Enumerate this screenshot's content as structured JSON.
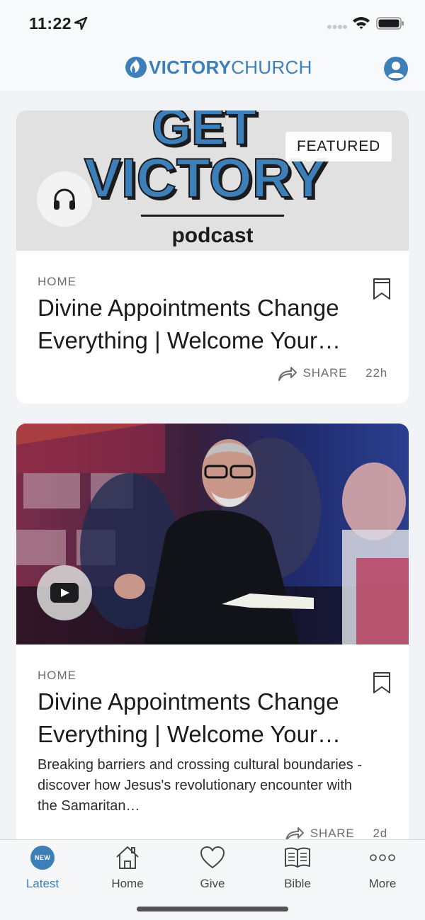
{
  "status_bar": {
    "time": "11:22",
    "icons": [
      "location-arrow-icon",
      "signal-icon",
      "wifi-icon",
      "battery-icon"
    ]
  },
  "header": {
    "brand_bold": "VICTORY",
    "brand_light": "CHURCH",
    "logo_icon": "flame-globe-icon",
    "profile_icon": "profile-icon"
  },
  "colors": {
    "accent": "#3d7fb8",
    "background": "#f2f3f6",
    "card": "#ffffff",
    "muted_text": "#6e6e73"
  },
  "feed": [
    {
      "media_type": "podcast",
      "media_icon": "headphones-icon",
      "artwork": {
        "line1": "GET",
        "line2": "VICTORY",
        "line3": "podcast"
      },
      "badge": "FEATURED",
      "category": "HOME",
      "title": "Divine Appointments Change Everything | Welcome Your…",
      "share_label": "SHARE",
      "age": "22h"
    },
    {
      "media_type": "video",
      "media_icon": "play-icon",
      "category": "HOME",
      "title": "Divine Appointments Change Everything | Welcome Your…",
      "description": "Breaking barriers and crossing cultural boundaries - discover how Jesus's revolutionary encounter with the Samaritan…",
      "share_label": "SHARE",
      "age": "2d"
    }
  ],
  "tab_bar": {
    "tabs": [
      {
        "label": "Latest",
        "icon": "new-badge-icon",
        "badge": "NEW",
        "active": true
      },
      {
        "label": "Home",
        "icon": "home-icon",
        "active": false
      },
      {
        "label": "Give",
        "icon": "heart-icon",
        "active": false
      },
      {
        "label": "Bible",
        "icon": "book-icon",
        "active": false
      },
      {
        "label": "More",
        "icon": "more-dots-icon",
        "active": false
      }
    ]
  }
}
